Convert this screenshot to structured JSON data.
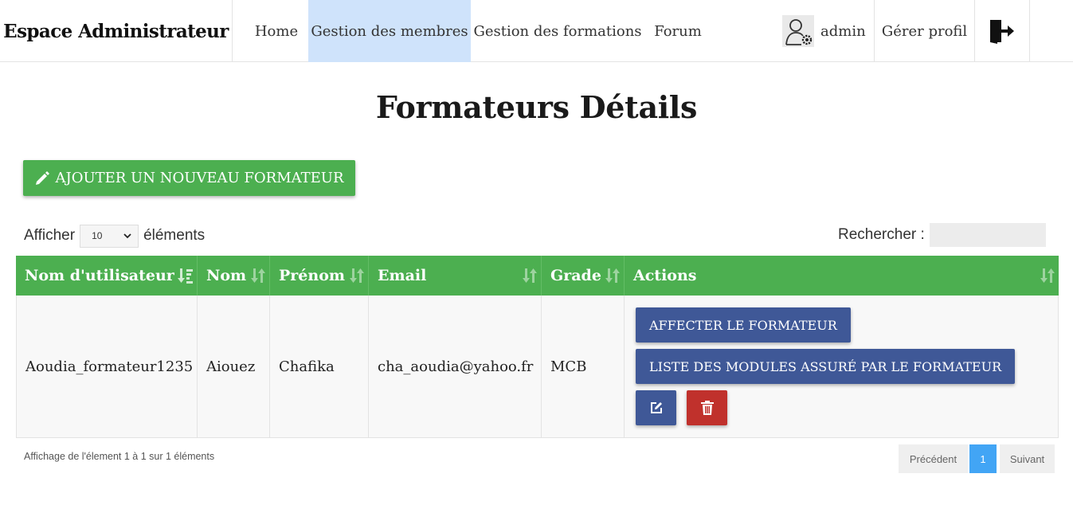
{
  "navbar": {
    "brand": "Espace Administrateur",
    "links": [
      {
        "label": "Home",
        "active": false
      },
      {
        "label": "Gestion des membres",
        "active": true
      },
      {
        "label": "Gestion des formations",
        "active": false
      },
      {
        "label": "Forum",
        "active": false
      }
    ],
    "user": {
      "name": "admin",
      "icon": "user-gear-icon"
    },
    "profile_label": "Gérer profil",
    "logout_icon": "logout-door-icon"
  },
  "page": {
    "title": "Formateurs Détails",
    "add_button": "AJOUTER UN NOUVEAU FORMATEUR"
  },
  "table_controls": {
    "show_prefix": "Afficher",
    "page_size": "10",
    "show_suffix": "éléments",
    "search_label": "Rechercher :",
    "search_value": ""
  },
  "table": {
    "columns": [
      "Nom d'utilisateur",
      "Nom",
      "Prénom",
      "Email",
      "Grade",
      "Actions"
    ],
    "rows": [
      {
        "username": "Aoudia_formateur1235",
        "nom": "Aiouez",
        "prenom": "Chafika",
        "email": "cha_aoudia@yahoo.fr",
        "grade": "MCB",
        "actions": {
          "assign": "AFFECTER LE FORMATEUR",
          "modules": "LISTE DES MODULES ASSURÉ PAR LE FORMATEUR"
        }
      }
    ]
  },
  "footer": {
    "info": "Affichage de l'élement 1 à 1 sur 1 éléments",
    "prev": "Précédent",
    "current_page": "1",
    "next": "Suivant"
  },
  "colors": {
    "green": "#4caf50",
    "blue": "#3f5897",
    "red": "#c0312c",
    "active_nav": "#cfe3fb",
    "page_active": "#42a5f5"
  }
}
